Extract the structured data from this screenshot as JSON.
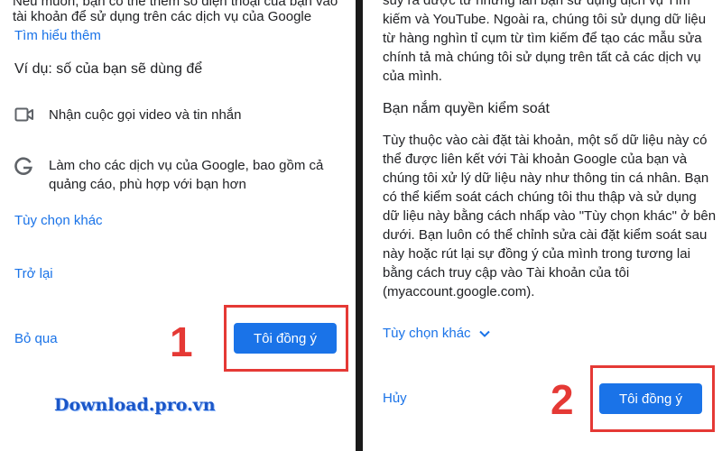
{
  "left": {
    "cut_text": "Nếu muốn, bạn có thể thêm số điện thoại của bạn vào",
    "intro_text": "tài khoản để sử dụng trên các dịch vụ của Google",
    "learn_more": "Tìm hiểu thêm",
    "example_heading": "Ví dụ: số của bạn sẽ dùng để",
    "items": [
      {
        "icon": "video-camera-icon",
        "lines": [
          "Nhận cuộc gọi video và tin nhắn"
        ]
      },
      {
        "icon": "google-g-icon",
        "lines": [
          "Làm cho các dịch vụ của Google, bao gồm cả",
          "quảng cáo, phù hợp với bạn hơn"
        ]
      }
    ],
    "more_options": "Tùy chọn khác",
    "back": "Trở lại",
    "skip": "Bỏ qua",
    "agree": "Tôi đồng ý",
    "step_number": "1"
  },
  "right": {
    "top_lines": [
      "suy ra được từ những lần bạn sử dụng dịch vụ Tìm",
      "kiếm và YouTube. Ngoài ra, chúng tôi sử dụng dữ liệu",
      "từ hàng nghìn tỉ cụm từ tìm kiếm để tạo các mẫu sửa",
      "chính tả mà chúng tôi sử dụng trên tất cả các dịch vụ",
      "của mình."
    ],
    "control_heading": "Bạn nắm quyền kiểm soát",
    "control_lines": [
      "Tùy thuộc vào cài đặt tài khoản, một số dữ liệu này có",
      "thể được liên kết với Tài khoản Google của bạn và",
      "chúng tôi xử lý dữ liệu này như thông tin cá nhân. Bạn",
      "có thể kiểm soát cách chúng tôi thu thập và sử dụng",
      "dữ liệu này bằng cách nhấp vào \"Tùy chọn khác\" ở bên",
      "dưới. Bạn luôn có thể chỉnh sửa cài đặt kiểm soát sau",
      "này hoặc rút lại sự đồng ý của mình trong tương lai",
      "bằng cách truy cập vào Tài khoản của tôi",
      "(myaccount.google.com)."
    ],
    "more_options": "Tùy chọn khác",
    "cancel": "Hủy",
    "agree": "Tôi đồng ý",
    "step_number": "2"
  },
  "watermark": "Download.pro.vn",
  "colors": {
    "accent": "#1a73e8",
    "highlight": "#e53935"
  }
}
